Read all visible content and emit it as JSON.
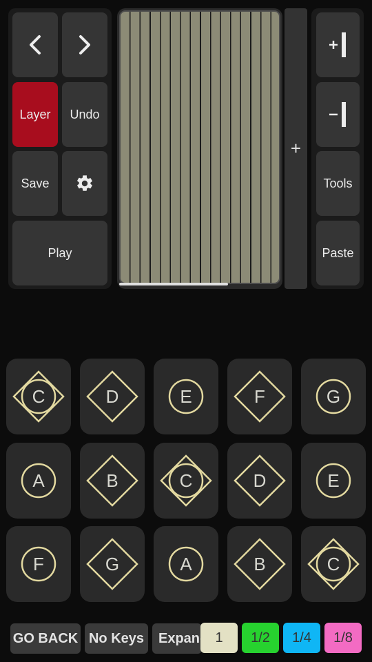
{
  "toolbar": {
    "prev_icon": "chevron-left-icon",
    "next_icon": "chevron-right-icon",
    "layer_label": "Layer",
    "undo_label": "Undo",
    "save_label": "Save",
    "settings_icon": "gear-icon",
    "play_label": "Play"
  },
  "right_tools": {
    "increase_icon": "plus-bar-icon",
    "decrease_icon": "minus-bar-icon",
    "tools_label": "Tools",
    "paste_label": "Paste"
  },
  "timeline": {
    "add_label": "+"
  },
  "pads": [
    {
      "note": "C",
      "shape": "both"
    },
    {
      "note": "D",
      "shape": "diamond"
    },
    {
      "note": "E",
      "shape": "circle"
    },
    {
      "note": "F",
      "shape": "diamond"
    },
    {
      "note": "G",
      "shape": "circle"
    },
    {
      "note": "A",
      "shape": "circle"
    },
    {
      "note": "B",
      "shape": "diamond"
    },
    {
      "note": "C",
      "shape": "both"
    },
    {
      "note": "D",
      "shape": "diamond"
    },
    {
      "note": "E",
      "shape": "circle"
    },
    {
      "note": "F",
      "shape": "circle"
    },
    {
      "note": "G",
      "shape": "diamond"
    },
    {
      "note": "A",
      "shape": "circle"
    },
    {
      "note": "B",
      "shape": "diamond"
    },
    {
      "note": "C",
      "shape": "both"
    }
  ],
  "bottom": {
    "go_back_label": "GO BACK",
    "no_keys_label": "No Keys",
    "expand_label": "Expand",
    "swatches": [
      {
        "label": "1",
        "color": "#e3e1c4"
      },
      {
        "label": "1/2",
        "color": "#27d22f"
      },
      {
        "label": "1/4",
        "color": "#0fb6f5"
      },
      {
        "label": "1/8",
        "color": "#f36bc3"
      }
    ]
  },
  "colors": {
    "accent_red": "#a80d1e",
    "pad_stroke": "#e3d9a0"
  }
}
